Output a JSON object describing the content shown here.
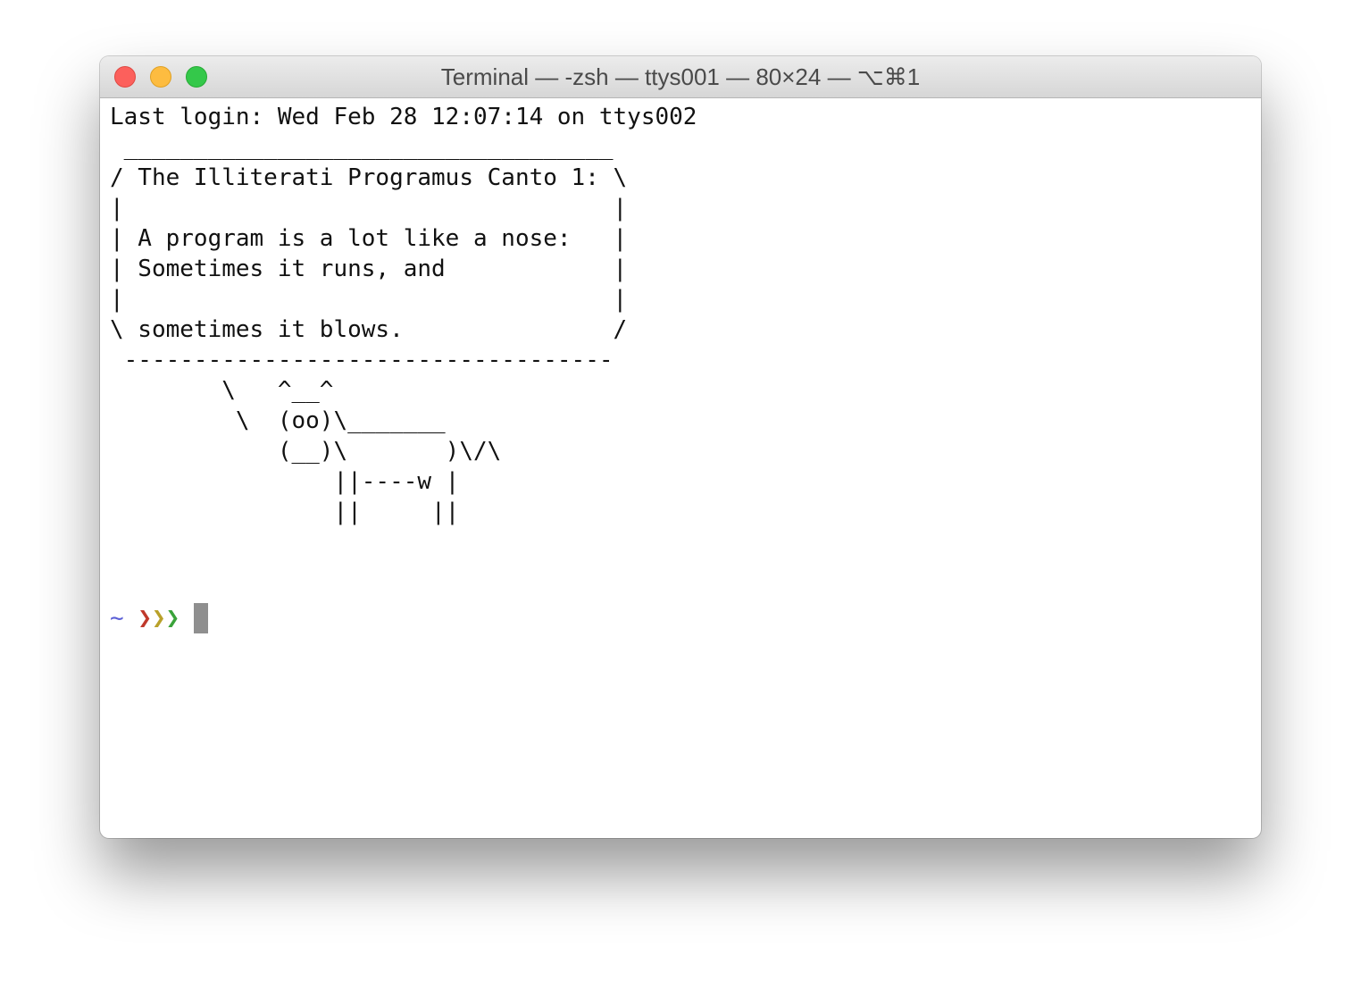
{
  "window": {
    "title": "Terminal — -zsh — ttys001 — 80×24 — ⌥⌘1"
  },
  "terminal": {
    "lines": [
      "Last login: Wed Feb 28 12:07:14 on ttys002",
      " ___________________________________",
      "/ The Illiterati Programus Canto 1: \\",
      "|                                   |",
      "| A program is a lot like a nose:   |",
      "| Sometimes it runs, and            |",
      "|                                   |",
      "\\ sometimes it blows.               /",
      " -----------------------------------",
      "        \\   ^__^",
      "         \\  (oo)\\_______",
      "            (__)\\       )\\/\\",
      "                ||----w |",
      "                ||     ||"
    ],
    "prompt": {
      "tilde": "~",
      "chevron_1": "❯",
      "chevron_2": "❯",
      "chevron_3": "❯"
    }
  },
  "colors": {
    "close": "#fc605c",
    "minimize": "#fdbc40",
    "zoom": "#34c84a",
    "tilde": "#5b5fd6",
    "chevron_1": "#c0392b",
    "chevron_2": "#b9a12a",
    "chevron_3": "#3aa33a",
    "cursor": "#8f8f8f"
  }
}
